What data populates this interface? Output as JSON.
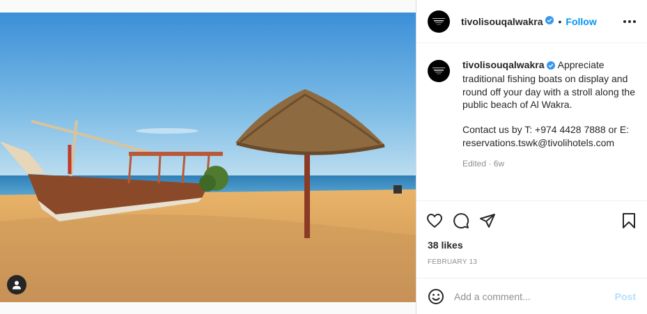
{
  "post": {
    "username": "tivolisouqalwakra",
    "follow_label": "Follow",
    "separator": "•",
    "caption": "Appreciate traditional fishing boats on display and round off your day with a stroll along the public beach of Al Wakra.\n\nContact us by T: +974 4428 7888 or E: reservations.tswk@tivolihotels.com",
    "edited_label": "Edited · 6w",
    "likes": "38 likes",
    "date": "FEBRUARY 13"
  },
  "comment": {
    "placeholder": "Add a comment...",
    "post_label": "Post"
  },
  "icons": {
    "verified": "verified-badge-icon",
    "more": "more-options-icon",
    "like": "heart-icon",
    "comment": "comment-icon",
    "share": "share-icon",
    "save": "bookmark-icon",
    "emoji": "emoji-icon",
    "user_tag": "user-tag-icon"
  },
  "colors": {
    "accent": "#0095f6",
    "verified": "#3897f0",
    "post_disabled": "#b2dffc"
  }
}
